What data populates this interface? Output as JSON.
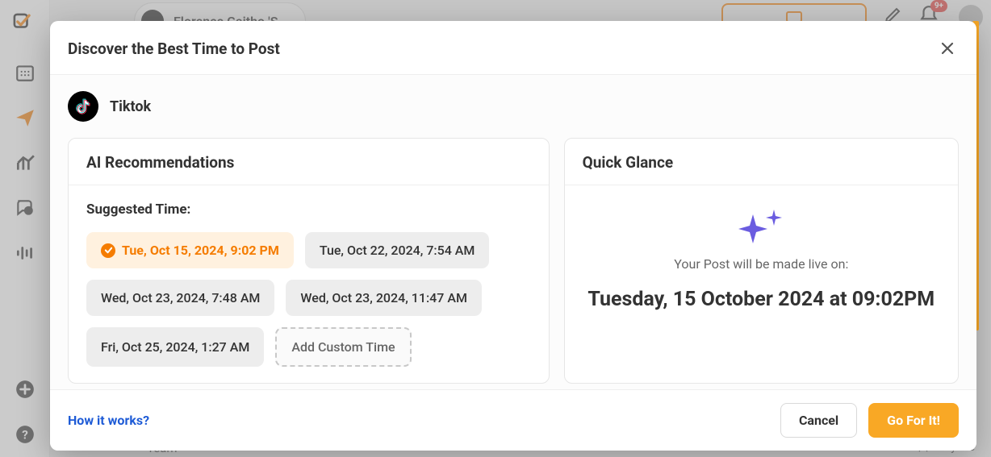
{
  "modal": {
    "title": "Discover the Best Time to Post",
    "platform": "Tiktok"
  },
  "recommendations": {
    "header": "AI Recommendations",
    "suggested_label": "Suggested Time:",
    "times": [
      "Tue, Oct 15, 2024, 9:02 PM",
      "Tue, Oct 22, 2024, 7:54 AM",
      "Wed, Oct 23, 2024, 7:48 AM",
      "Wed, Oct 23, 2024, 11:47 AM",
      "Fri, Oct 25, 2024, 1:27 AM"
    ],
    "add_custom": "Add Custom Time"
  },
  "glance": {
    "header": "Quick Glance",
    "sub": "Your Post will be made live on:",
    "main": "Tuesday, 15 October 2024 at 09:02PM"
  },
  "footer": {
    "how_link": "How it works?",
    "cancel": "Cancel",
    "go": "Go For It!"
  },
  "background": {
    "user_pill": "Florence Gaitho 'S …",
    "bell_badge": "9+",
    "only_me": "Only Me",
    "team": "Team"
  }
}
